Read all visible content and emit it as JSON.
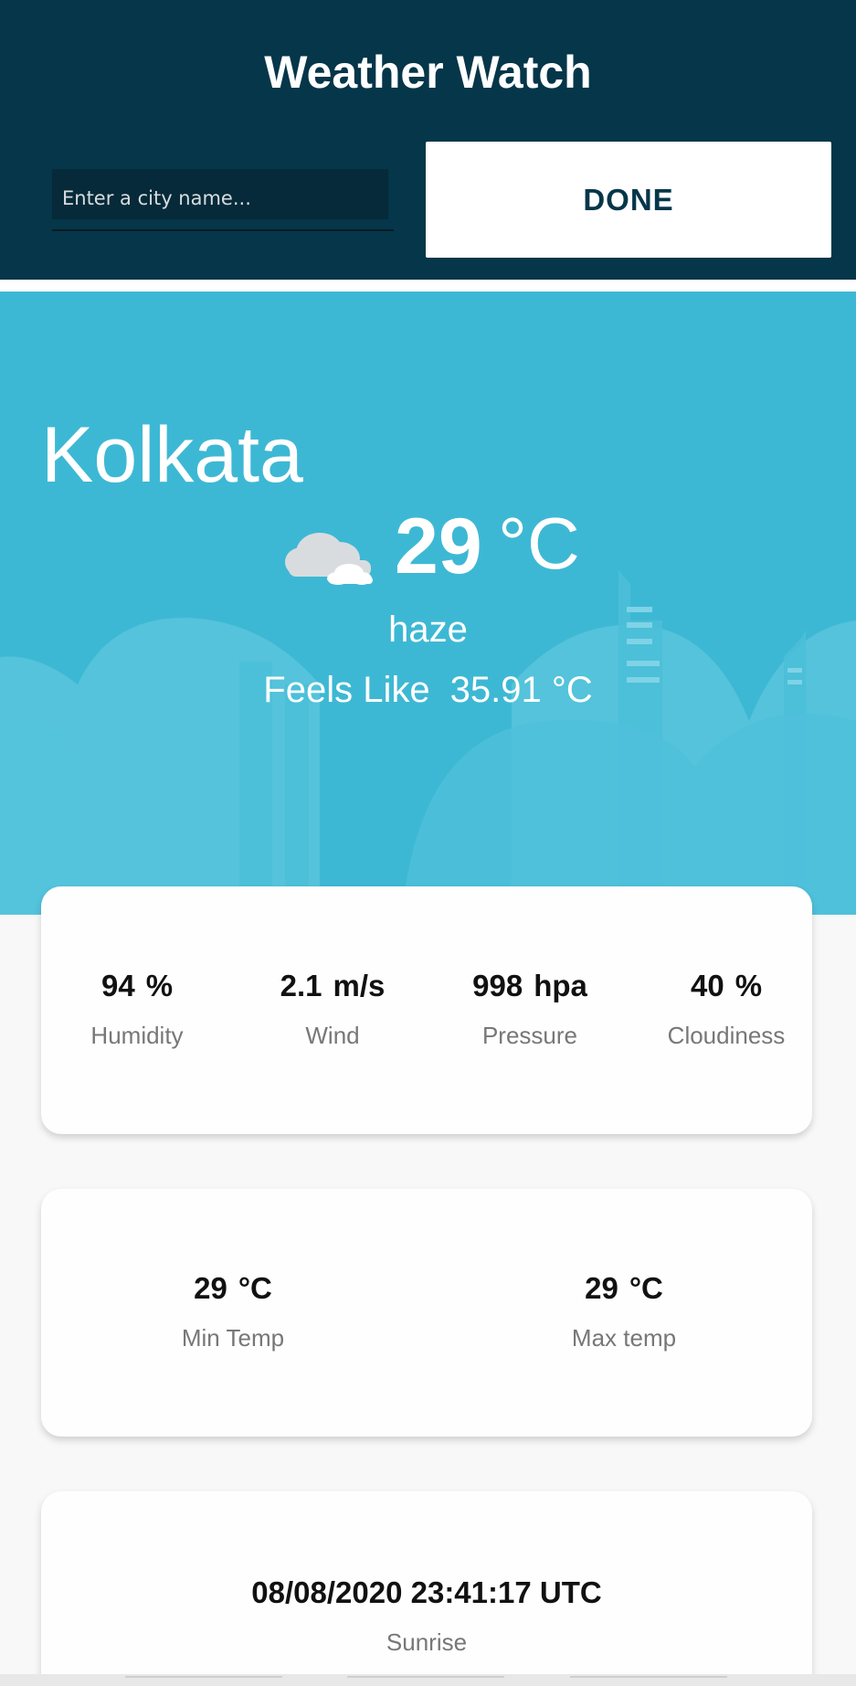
{
  "header": {
    "title": "Weather Watch",
    "search_placeholder": "Enter a city name...",
    "done_label": "DONE"
  },
  "current": {
    "city": "Kolkata",
    "temp": "29",
    "temp_unit": "°C",
    "icon": "partly-cloudy-icon",
    "description": "haze",
    "feels_like_label": "Feels Like",
    "feels_like_value": "35.91 °C"
  },
  "stats": [
    {
      "value": "94",
      "unit": "%",
      "label": "Humidity"
    },
    {
      "value": "2.1",
      "unit": "m/s",
      "label": "Wind"
    },
    {
      "value": "998",
      "unit": "hpa",
      "label": "Pressure"
    },
    {
      "value": "40",
      "unit": "%",
      "label": "Cloudiness"
    }
  ],
  "temps": [
    {
      "value": "29",
      "unit": "°C",
      "label": "Min Temp"
    },
    {
      "value": "29",
      "unit": "°C",
      "label": "Max temp"
    }
  ],
  "sun": {
    "value": "08/08/2020 23:41:17 UTC",
    "label": "Sunrise"
  },
  "colors": {
    "header_bg": "#053649",
    "hero_bg": "#3db8d4",
    "card_bg": "#fdfefd",
    "page_bg": "#f7f8f7"
  }
}
